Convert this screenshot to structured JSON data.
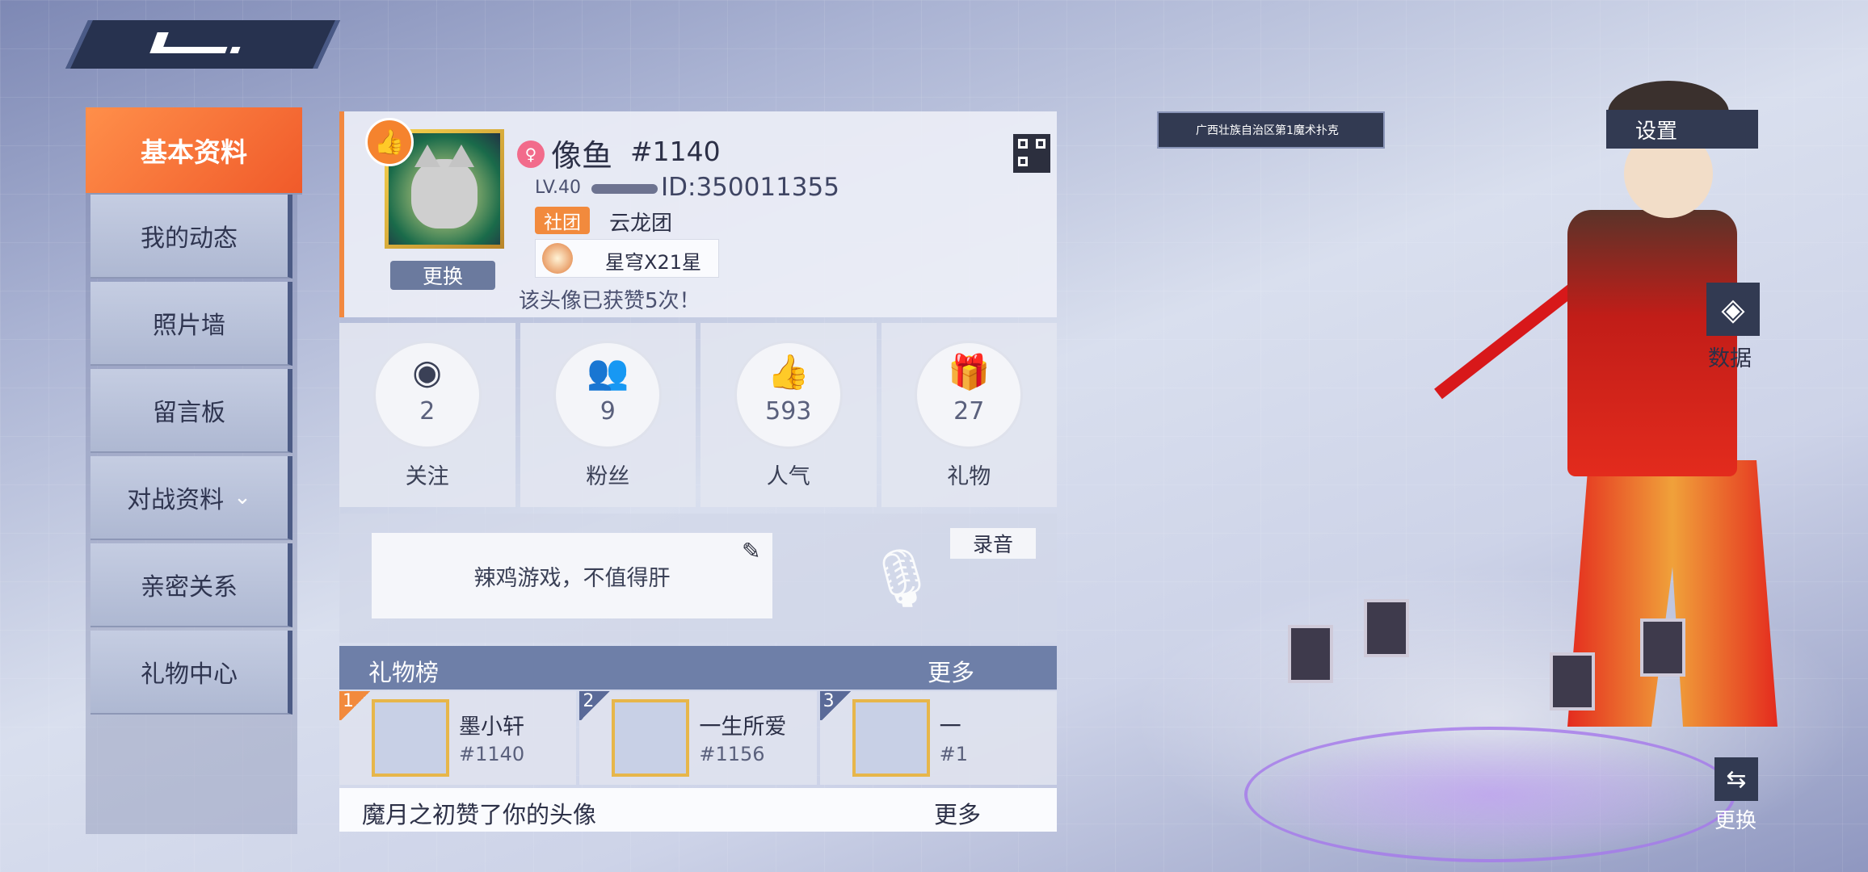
{
  "nav": {
    "items": [
      {
        "label": "基本资料"
      },
      {
        "label": "我的动态"
      },
      {
        "label": "照片墙"
      },
      {
        "label": "留言板"
      },
      {
        "label": "对战资料"
      },
      {
        "label": "亲密关系"
      },
      {
        "label": "礼物中心"
      }
    ]
  },
  "profile": {
    "nickname": "像鱼",
    "tag": "#1140",
    "level": "LV.40",
    "player_id": "ID:350011355",
    "club_tag": "社团",
    "club_name": "云龙团",
    "rank": "星穹X21星",
    "change_label": "更换",
    "avatar_likes": "该头像已获赞5次！"
  },
  "stats": [
    {
      "icon": "eye-icon",
      "value": "2",
      "label": "关注"
    },
    {
      "icon": "fans-icon",
      "value": "9",
      "label": "粉丝"
    },
    {
      "icon": "thumb-up-icon",
      "value": "593",
      "label": "人气"
    },
    {
      "icon": "gift-icon",
      "value": "27",
      "label": "礼物"
    }
  ],
  "signature": {
    "text": "辣鸡游戏，不值得肝",
    "record_label": "录音"
  },
  "gift_board": {
    "title": "礼物榜",
    "more_label": "更多",
    "entries": [
      {
        "rank": "1",
        "name": "墨小轩",
        "id": "#1140"
      },
      {
        "rank": "2",
        "name": "一生所爱",
        "id": "#1156"
      },
      {
        "rank": "3",
        "name": "一",
        "id": "#1"
      }
    ]
  },
  "news": {
    "text": "魔月之初赞了你的头像",
    "more_label": "更多"
  },
  "right": {
    "location": "广西壮族自治区第1魔术扑克",
    "settings_label": "设置",
    "data_label": "数据",
    "swap_label": "更换"
  },
  "colors": {
    "accent_orange": "#f05a2a",
    "panel_dark": "#323a52",
    "gift_header": "#6e7fa8"
  }
}
